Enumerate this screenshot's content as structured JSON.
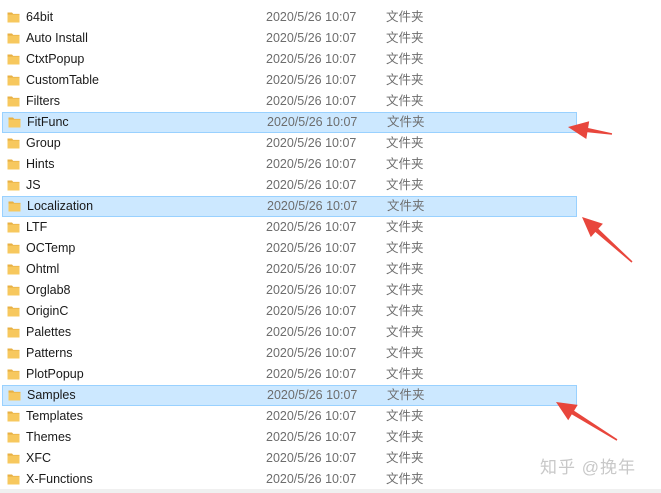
{
  "colors": {
    "folder": "#f7c85e",
    "folder_dark": "#e8b043",
    "selection": "#cce8ff",
    "arrow": "#e8463c"
  },
  "rows": [
    {
      "name": "64bit",
      "date": "2020/5/26 10:07",
      "type": "文件夹",
      "selected": false,
      "icon": "folder-icon"
    },
    {
      "name": "Auto Install",
      "date": "2020/5/26 10:07",
      "type": "文件夹",
      "selected": false,
      "icon": "folder-icon"
    },
    {
      "name": "CtxtPopup",
      "date": "2020/5/26 10:07",
      "type": "文件夹",
      "selected": false,
      "icon": "folder-icon"
    },
    {
      "name": "CustomTable",
      "date": "2020/5/26 10:07",
      "type": "文件夹",
      "selected": false,
      "icon": "folder-icon"
    },
    {
      "name": "Filters",
      "date": "2020/5/26 10:07",
      "type": "文件夹",
      "selected": false,
      "icon": "folder-icon"
    },
    {
      "name": "FitFunc",
      "date": "2020/5/26 10:07",
      "type": "文件夹",
      "selected": true,
      "icon": "folder-icon"
    },
    {
      "name": "Group",
      "date": "2020/5/26 10:07",
      "type": "文件夹",
      "selected": false,
      "icon": "folder-icon"
    },
    {
      "name": "Hints",
      "date": "2020/5/26 10:07",
      "type": "文件夹",
      "selected": false,
      "icon": "folder-icon"
    },
    {
      "name": "JS",
      "date": "2020/5/26 10:07",
      "type": "文件夹",
      "selected": false,
      "icon": "folder-icon"
    },
    {
      "name": "Localization",
      "date": "2020/5/26 10:07",
      "type": "文件夹",
      "selected": true,
      "icon": "folder-icon"
    },
    {
      "name": "LTF",
      "date": "2020/5/26 10:07",
      "type": "文件夹",
      "selected": false,
      "icon": "folder-icon"
    },
    {
      "name": "OCTemp",
      "date": "2020/5/26 10:07",
      "type": "文件夹",
      "selected": false,
      "icon": "folder-icon"
    },
    {
      "name": "Ohtml",
      "date": "2020/5/26 10:07",
      "type": "文件夹",
      "selected": false,
      "icon": "folder-icon"
    },
    {
      "name": "Orglab8",
      "date": "2020/5/26 10:07",
      "type": "文件夹",
      "selected": false,
      "icon": "folder-icon"
    },
    {
      "name": "OriginC",
      "date": "2020/5/26 10:07",
      "type": "文件夹",
      "selected": false,
      "icon": "folder-icon"
    },
    {
      "name": "Palettes",
      "date": "2020/5/26 10:07",
      "type": "文件夹",
      "selected": false,
      "icon": "folder-icon"
    },
    {
      "name": "Patterns",
      "date": "2020/5/26 10:07",
      "type": "文件夹",
      "selected": false,
      "icon": "folder-icon"
    },
    {
      "name": "PlotPopup",
      "date": "2020/5/26 10:07",
      "type": "文件夹",
      "selected": false,
      "icon": "folder-icon"
    },
    {
      "name": "Samples",
      "date": "2020/5/26 10:07",
      "type": "文件夹",
      "selected": true,
      "icon": "folder-icon"
    },
    {
      "name": "Templates",
      "date": "2020/5/26 10:07",
      "type": "文件夹",
      "selected": false,
      "icon": "folder-icon"
    },
    {
      "name": "Themes",
      "date": "2020/5/26 10:07",
      "type": "文件夹",
      "selected": false,
      "icon": "folder-icon"
    },
    {
      "name": "XFC",
      "date": "2020/5/26 10:07",
      "type": "文件夹",
      "selected": false,
      "icon": "folder-icon"
    },
    {
      "name": "X-Functions",
      "date": "2020/5/26 10:07",
      "type": "文件夹",
      "selected": false,
      "icon": "folder-icon"
    }
  ],
  "annotations": [
    {
      "icon": "red-arrow-icon",
      "points_to": "FitFunc"
    },
    {
      "icon": "red-arrow-icon",
      "points_to": "Localization"
    },
    {
      "icon": "red-arrow-icon",
      "points_to": "Samples"
    }
  ],
  "watermark": {
    "text": "知乎 @挽年"
  }
}
